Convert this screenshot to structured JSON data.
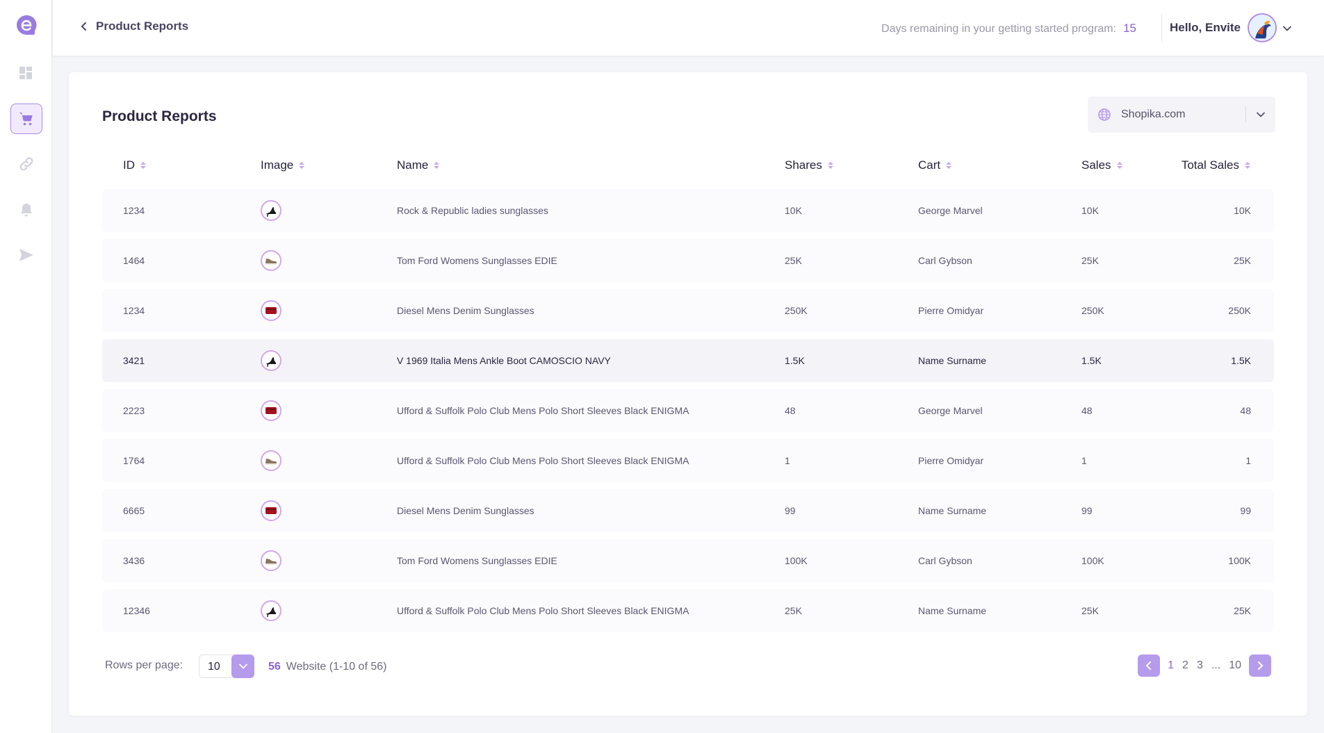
{
  "colors": {
    "accent": "#8a63d2",
    "accent_soft": "#b59bec",
    "sidebar_active_bg": "#f1eafd",
    "icon_gray": "#d3d4dc"
  },
  "sidebar": {
    "logo_icon": "e-logo-icon",
    "items": [
      {
        "icon": "dashboard-icon",
        "active": false
      },
      {
        "icon": "cart-icon",
        "active": true
      },
      {
        "icon": "link-icon",
        "active": false
      },
      {
        "icon": "bell-icon",
        "active": false
      },
      {
        "icon": "send-icon",
        "active": false
      }
    ]
  },
  "header": {
    "back_label": "Product Reports",
    "days_label": "Days remaining in your getting started program:",
    "days_value": "15",
    "greeting": "Hello, Envite"
  },
  "card": {
    "title": "Product Reports",
    "site_select_value": "Shopika.com"
  },
  "table": {
    "columns": [
      "ID",
      "Image",
      "Name",
      "Shares",
      "Cart",
      "Sales",
      "Total Sales"
    ],
    "rows": [
      {
        "id": "1234",
        "image": "heel",
        "name": "Rock & Republic ladies sunglasses",
        "shares": "10K",
        "cart": "George Marvel",
        "sales": "10K",
        "total": "10K"
      },
      {
        "id": "1464",
        "image": "sneaker",
        "name": "Tom Ford Womens Sunglasses EDIE",
        "shares": "25K",
        "cart": "Carl Gybson",
        "sales": "25K",
        "total": "25K"
      },
      {
        "id": "1234",
        "image": "wallet",
        "name": "Diesel Mens Denim Sunglasses",
        "shares": "250K",
        "cart": "Pierre Omidyar",
        "sales": "250K",
        "total": "250K"
      },
      {
        "id": "3421",
        "image": "heel",
        "name": "V 1969 Italia Mens Ankle Boot CAMOSCIO NAVY",
        "shares": "1.5K",
        "cart": "Name Surname",
        "sales": "1.5K",
        "total": "1.5K"
      },
      {
        "id": "2223",
        "image": "wallet",
        "name": "Ufford & Suffolk Polo Club Mens Polo Short Sleeves Black ENIGMA",
        "shares": "48",
        "cart": "George Marvel",
        "sales": "48",
        "total": "48"
      },
      {
        "id": "1764",
        "image": "sneaker",
        "name": "Ufford & Suffolk Polo Club Mens Polo Short Sleeves Black ENIGMA",
        "shares": "1",
        "cart": "Pierre Omidyar",
        "sales": "1",
        "total": "1"
      },
      {
        "id": "6665",
        "image": "wallet",
        "name": "Diesel Mens Denim Sunglasses",
        "shares": "99",
        "cart": "Name Surname",
        "sales": "99",
        "total": "99"
      },
      {
        "id": "3436",
        "image": "sneaker",
        "name": "Tom Ford Womens Sunglasses EDIE",
        "shares": "100K",
        "cart": "Carl Gybson",
        "sales": "100K",
        "total": "100K"
      },
      {
        "id": "12346",
        "image": "heel",
        "name": "Ufford & Suffolk Polo Club Mens Polo Short Sleeves Black ENIGMA",
        "shares": "25K",
        "cart": "Name Surname",
        "sales": "25K",
        "total": "25K"
      }
    ]
  },
  "footer": {
    "rows_per_page_label": "Rows per page:",
    "rows_per_page_value": "10",
    "total_count": "56",
    "count_text": "Website (1-10 of 56)",
    "pages": [
      "1",
      "2",
      "3",
      "...",
      "10"
    ],
    "active_page": "1"
  }
}
